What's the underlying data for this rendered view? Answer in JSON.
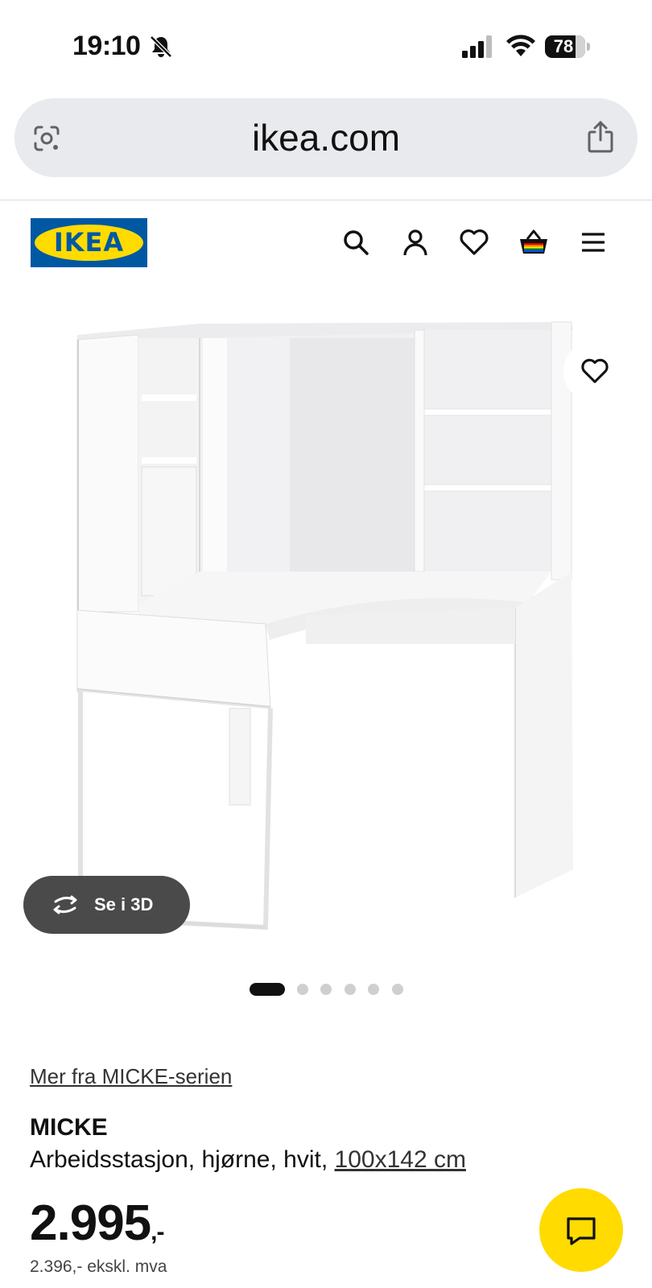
{
  "status_bar": {
    "time": "19:10",
    "battery": "78",
    "icons": [
      "bell-off-icon",
      "cellular-signal-icon",
      "wifi-icon",
      "battery-icon"
    ]
  },
  "browser": {
    "url": "ikea.com",
    "icons": [
      "google-lens-icon",
      "share-icon"
    ]
  },
  "header": {
    "logo_text": "IKEA",
    "icons": [
      "search-icon",
      "account-icon",
      "wishlist-heart-icon",
      "shopping-basket-icon",
      "menu-icon"
    ]
  },
  "gallery": {
    "see_3d_label": "Se i 3D",
    "image_count": 6,
    "active_index": 0
  },
  "product": {
    "series_link": "Mer fra MICKE-serien",
    "name": "MICKE",
    "description": "Arbeidsstasjon, hjørne, hvit,",
    "dimensions": "100x142 cm",
    "price_main": "2.995",
    "price_suffix": ",-",
    "price_excl_vat": "2.396,- ekskl. mva"
  },
  "colors": {
    "ikea_blue": "#0058a3",
    "ikea_yellow": "#ffdb00",
    "url_bar_bg": "#e9eaee"
  }
}
